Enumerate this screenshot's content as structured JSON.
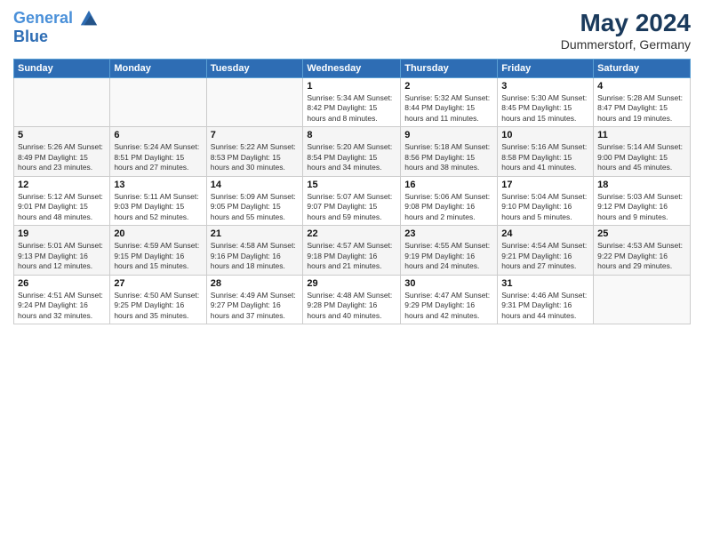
{
  "logo": {
    "line1": "General",
    "line2": "Blue"
  },
  "title": "May 2024",
  "subtitle": "Dummerstorf, Germany",
  "days_of_week": [
    "Sunday",
    "Monday",
    "Tuesday",
    "Wednesday",
    "Thursday",
    "Friday",
    "Saturday"
  ],
  "weeks": [
    [
      {
        "day": "",
        "info": ""
      },
      {
        "day": "",
        "info": ""
      },
      {
        "day": "",
        "info": ""
      },
      {
        "day": "1",
        "info": "Sunrise: 5:34 AM\nSunset: 8:42 PM\nDaylight: 15 hours\nand 8 minutes."
      },
      {
        "day": "2",
        "info": "Sunrise: 5:32 AM\nSunset: 8:44 PM\nDaylight: 15 hours\nand 11 minutes."
      },
      {
        "day": "3",
        "info": "Sunrise: 5:30 AM\nSunset: 8:45 PM\nDaylight: 15 hours\nand 15 minutes."
      },
      {
        "day": "4",
        "info": "Sunrise: 5:28 AM\nSunset: 8:47 PM\nDaylight: 15 hours\nand 19 minutes."
      }
    ],
    [
      {
        "day": "5",
        "info": "Sunrise: 5:26 AM\nSunset: 8:49 PM\nDaylight: 15 hours\nand 23 minutes."
      },
      {
        "day": "6",
        "info": "Sunrise: 5:24 AM\nSunset: 8:51 PM\nDaylight: 15 hours\nand 27 minutes."
      },
      {
        "day": "7",
        "info": "Sunrise: 5:22 AM\nSunset: 8:53 PM\nDaylight: 15 hours\nand 30 minutes."
      },
      {
        "day": "8",
        "info": "Sunrise: 5:20 AM\nSunset: 8:54 PM\nDaylight: 15 hours\nand 34 minutes."
      },
      {
        "day": "9",
        "info": "Sunrise: 5:18 AM\nSunset: 8:56 PM\nDaylight: 15 hours\nand 38 minutes."
      },
      {
        "day": "10",
        "info": "Sunrise: 5:16 AM\nSunset: 8:58 PM\nDaylight: 15 hours\nand 41 minutes."
      },
      {
        "day": "11",
        "info": "Sunrise: 5:14 AM\nSunset: 9:00 PM\nDaylight: 15 hours\nand 45 minutes."
      }
    ],
    [
      {
        "day": "12",
        "info": "Sunrise: 5:12 AM\nSunset: 9:01 PM\nDaylight: 15 hours\nand 48 minutes."
      },
      {
        "day": "13",
        "info": "Sunrise: 5:11 AM\nSunset: 9:03 PM\nDaylight: 15 hours\nand 52 minutes."
      },
      {
        "day": "14",
        "info": "Sunrise: 5:09 AM\nSunset: 9:05 PM\nDaylight: 15 hours\nand 55 minutes."
      },
      {
        "day": "15",
        "info": "Sunrise: 5:07 AM\nSunset: 9:07 PM\nDaylight: 15 hours\nand 59 minutes."
      },
      {
        "day": "16",
        "info": "Sunrise: 5:06 AM\nSunset: 9:08 PM\nDaylight: 16 hours\nand 2 minutes."
      },
      {
        "day": "17",
        "info": "Sunrise: 5:04 AM\nSunset: 9:10 PM\nDaylight: 16 hours\nand 5 minutes."
      },
      {
        "day": "18",
        "info": "Sunrise: 5:03 AM\nSunset: 9:12 PM\nDaylight: 16 hours\nand 9 minutes."
      }
    ],
    [
      {
        "day": "19",
        "info": "Sunrise: 5:01 AM\nSunset: 9:13 PM\nDaylight: 16 hours\nand 12 minutes."
      },
      {
        "day": "20",
        "info": "Sunrise: 4:59 AM\nSunset: 9:15 PM\nDaylight: 16 hours\nand 15 minutes."
      },
      {
        "day": "21",
        "info": "Sunrise: 4:58 AM\nSunset: 9:16 PM\nDaylight: 16 hours\nand 18 minutes."
      },
      {
        "day": "22",
        "info": "Sunrise: 4:57 AM\nSunset: 9:18 PM\nDaylight: 16 hours\nand 21 minutes."
      },
      {
        "day": "23",
        "info": "Sunrise: 4:55 AM\nSunset: 9:19 PM\nDaylight: 16 hours\nand 24 minutes."
      },
      {
        "day": "24",
        "info": "Sunrise: 4:54 AM\nSunset: 9:21 PM\nDaylight: 16 hours\nand 27 minutes."
      },
      {
        "day": "25",
        "info": "Sunrise: 4:53 AM\nSunset: 9:22 PM\nDaylight: 16 hours\nand 29 minutes."
      }
    ],
    [
      {
        "day": "26",
        "info": "Sunrise: 4:51 AM\nSunset: 9:24 PM\nDaylight: 16 hours\nand 32 minutes."
      },
      {
        "day": "27",
        "info": "Sunrise: 4:50 AM\nSunset: 9:25 PM\nDaylight: 16 hours\nand 35 minutes."
      },
      {
        "day": "28",
        "info": "Sunrise: 4:49 AM\nSunset: 9:27 PM\nDaylight: 16 hours\nand 37 minutes."
      },
      {
        "day": "29",
        "info": "Sunrise: 4:48 AM\nSunset: 9:28 PM\nDaylight: 16 hours\nand 40 minutes."
      },
      {
        "day": "30",
        "info": "Sunrise: 4:47 AM\nSunset: 9:29 PM\nDaylight: 16 hours\nand 42 minutes."
      },
      {
        "day": "31",
        "info": "Sunrise: 4:46 AM\nSunset: 9:31 PM\nDaylight: 16 hours\nand 44 minutes."
      },
      {
        "day": "",
        "info": ""
      }
    ]
  ]
}
